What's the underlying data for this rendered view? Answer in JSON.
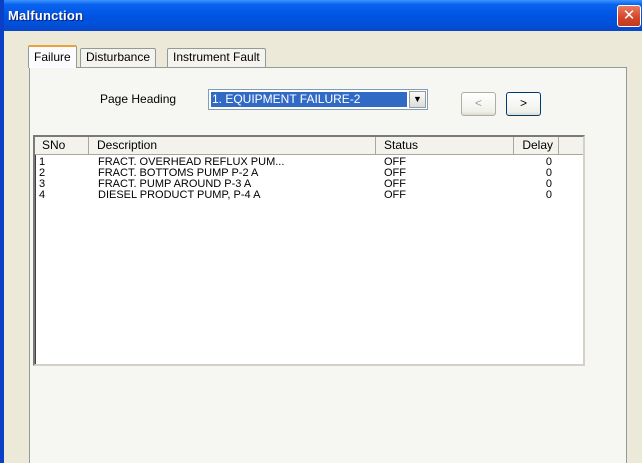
{
  "window": {
    "title": "Malfunction",
    "close_glyph": "✕"
  },
  "tabs": [
    {
      "label": "Failure",
      "active": true
    },
    {
      "label": "Disturbance",
      "active": false
    },
    {
      "label": "Instrument Fault",
      "active": false
    }
  ],
  "page_heading": {
    "label": "Page Heading",
    "selected": "1. EQUIPMENT FAILURE-2"
  },
  "nav": {
    "prev_label": "<",
    "next_label": ">"
  },
  "table": {
    "columns": [
      "SNo",
      "Description",
      "Status",
      "Delay"
    ],
    "rows": [
      {
        "sno": "1",
        "description": "FRACT. OVERHEAD REFLUX PUM...",
        "status": "OFF",
        "delay": "0"
      },
      {
        "sno": "2",
        "description": "FRACT.  BOTTOMS PUMP P-2 A",
        "status": "OFF",
        "delay": "0"
      },
      {
        "sno": "3",
        "description": "FRACT.  PUMP AROUND P-3 A",
        "status": "OFF",
        "delay": "0"
      },
      {
        "sno": "4",
        "description": "DIESEL PRODUCT PUMP, P-4 A",
        "status": "OFF",
        "delay": "0"
      }
    ]
  },
  "colors": {
    "titlebar": "#0054e3",
    "selection": "#316ac5",
    "dialog_bg": "#ece9d8"
  }
}
